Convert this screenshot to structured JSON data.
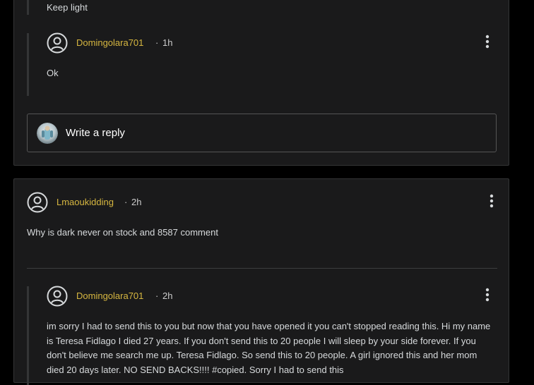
{
  "thread_top": {
    "prev_comment_text": "Keep light",
    "reply": {
      "username": "Domingolara701",
      "separator": "·",
      "time": "1h",
      "text": "Ok"
    },
    "reply_box": {
      "placeholder": "Write a reply"
    }
  },
  "thread_bottom": {
    "comment": {
      "username": "Lmaoukidding",
      "separator": "·",
      "time": "2h",
      "text": "Why is dark never on stock and 8587 comment"
    },
    "reply": {
      "username": "Domingolara701",
      "separator": "·",
      "time": "2h",
      "text": "im sorry I had to send this to you but now that you have opened it you can't stopped reading this. Hi my name is Teresa Fidlago I died 27 years. If you don't send this to 20 people I will sleep by your side forever. If you don't believe me search me up. Teresa Fidlago. So send this to 20 people. A girl ignored this and her mom died 20 days later. NO SEND BACKS!!!! #copied. Sorry I had to send this"
    }
  },
  "colors": {
    "username": "#d7b740",
    "background": "#000000",
    "card": "#1a1a1b",
    "border": "#343536"
  },
  "icons": {
    "avatar": "user-circle-icon",
    "menu": "vertical-dots-icon"
  }
}
